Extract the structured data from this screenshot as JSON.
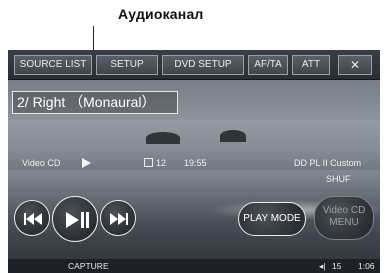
{
  "callout": {
    "label": "Аудиоканал"
  },
  "tabs": {
    "source_list": "SOURCE LIST",
    "setup": "SETUP",
    "dvd_setup": "DVD SETUP",
    "af_ta": "AF/TA",
    "att": "ATT",
    "close": "✕"
  },
  "audio_channel": "2/ Right （Monaural）",
  "status": {
    "source": "Video CD",
    "play_state_icon": "play-icon",
    "chapter_icon": "scene-icon",
    "chapter": "12",
    "time": "19:55",
    "sound_mode": "DD PL II Custom",
    "repeat_shuffle": "SHUF"
  },
  "controls": {
    "prev_icon": "skip-previous-icon",
    "play_pause_icon": "play-pause-icon",
    "next_icon": "skip-next-icon",
    "play_mode": "PLAY MODE",
    "video_cd_menu_line1": "Video CD",
    "video_cd_menu_line2": "MENU"
  },
  "bottom": {
    "capture": "CAPTURE",
    "volume": "15",
    "clock": "1:06"
  }
}
